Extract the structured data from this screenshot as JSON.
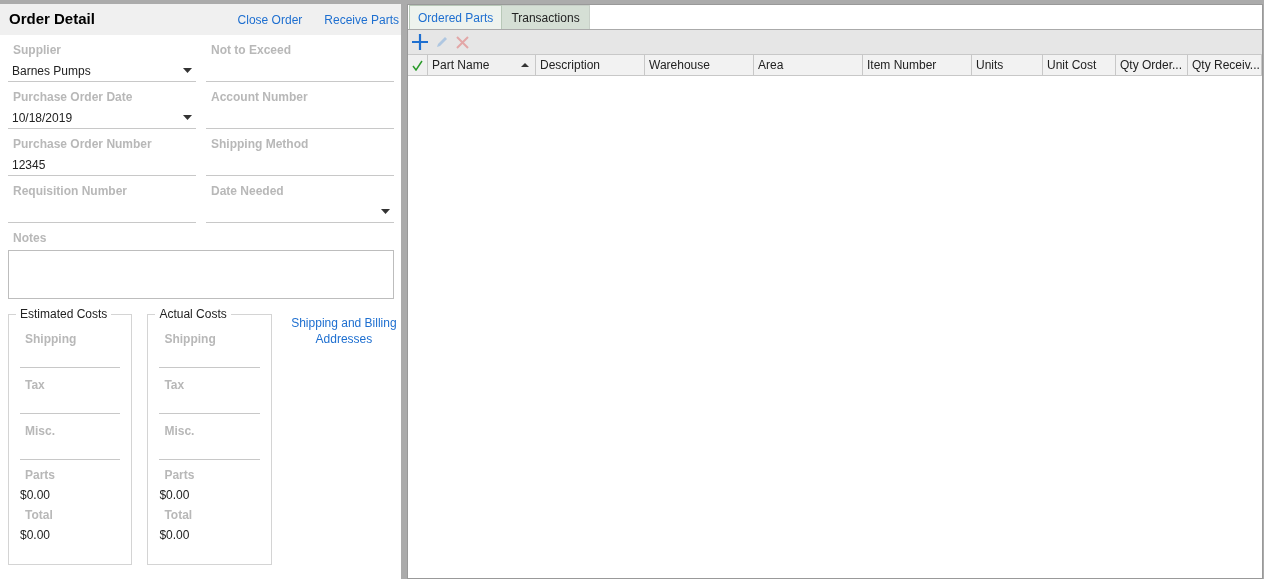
{
  "order_detail": {
    "title": "Order Detail",
    "actions": [
      "Close Order",
      "Receive Parts"
    ],
    "fields": [
      {
        "label": "Supplier",
        "kind": "dropdown",
        "value": "Barnes Pumps"
      },
      {
        "label": "Not to Exceed",
        "kind": "text"
      },
      {
        "label": "Purchase Order Date",
        "kind": "dropdown",
        "value": "10/18/2019"
      },
      {
        "label": "Account Number",
        "kind": "text"
      },
      {
        "label": "Purchase Order Number",
        "kind": "text",
        "value": "12345"
      },
      {
        "label": "Shipping Method",
        "kind": "text"
      },
      {
        "label": "Requisition Number",
        "kind": "text"
      },
      {
        "label": "Date Needed",
        "kind": "dropdown"
      }
    ],
    "notes": {
      "label": "Notes"
    },
    "cost_groups": [
      {
        "title": "Estimated Costs",
        "fields": [
          {
            "label": "Shipping"
          },
          {
            "label": "Tax"
          },
          {
            "label": "Misc."
          }
        ],
        "totals": [
          {
            "label": "Parts",
            "value": "$0.00"
          },
          {
            "label": "Total",
            "value": "$0.00"
          }
        ]
      },
      {
        "title": "Actual Costs",
        "fields": [
          {
            "label": "Shipping"
          },
          {
            "label": "Tax"
          },
          {
            "label": "Misc."
          }
        ],
        "totals": [
          {
            "label": "Parts",
            "value": "$0.00"
          },
          {
            "label": "Total",
            "value": "$0.00"
          }
        ]
      }
    ],
    "addresses_link": "Shipping and Billing Addresses"
  },
  "tabs": [
    {
      "label": "Ordered Parts",
      "selected": true
    },
    {
      "label": "Transactions",
      "selected": false
    }
  ],
  "toolbar": [
    {
      "kind": "add",
      "disabled": false
    },
    {
      "kind": "edit",
      "disabled": true
    },
    {
      "kind": "delete",
      "disabled": true
    }
  ],
  "table": {
    "columns": [
      {
        "label": "Part Name",
        "sorted": true
      },
      {
        "label": "Description",
        "sorted": false
      },
      {
        "label": "Warehouse",
        "sorted": false
      },
      {
        "label": "Area",
        "sorted": false
      },
      {
        "label": "Item Number",
        "sorted": false
      },
      {
        "label": "Units",
        "sorted": false
      },
      {
        "label": "Unit Cost",
        "sorted": false
      },
      {
        "label": "Qty Order...",
        "sorted": false
      },
      {
        "label": "Qty Receiv...",
        "sorted": false
      }
    ]
  }
}
